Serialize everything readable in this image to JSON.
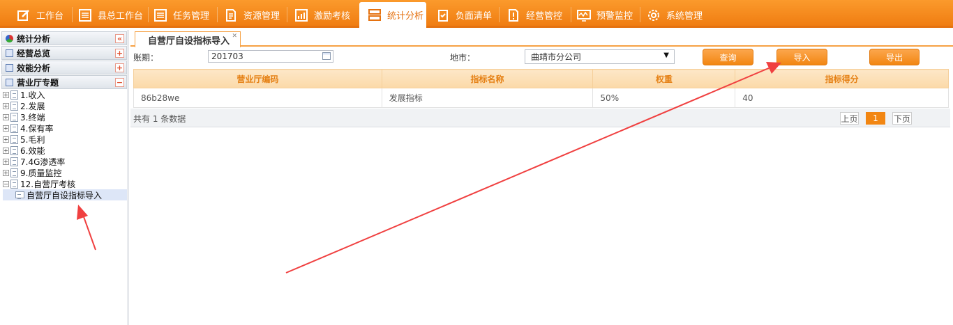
{
  "nav": {
    "items": [
      {
        "label": "工作台",
        "icon": "edit-icon"
      },
      {
        "label": "县总工作台",
        "icon": "list-icon"
      },
      {
        "label": "任务管理",
        "icon": "task-list-icon"
      },
      {
        "label": "资源管理",
        "icon": "document-icon"
      },
      {
        "label": "激励考核",
        "icon": "bar-chart-icon"
      },
      {
        "label": "统计分析",
        "icon": "server-icon",
        "active": true
      },
      {
        "label": "负面清单",
        "icon": "clipboard-check-icon"
      },
      {
        "label": "经营管控",
        "icon": "alert-file-icon"
      },
      {
        "label": "预警监控",
        "icon": "monitor-icon"
      },
      {
        "label": "系统管理",
        "icon": "gear-icon"
      }
    ]
  },
  "sidebar": {
    "title": "统计分析",
    "sections": [
      "经营总览",
      "效能分析",
      "营业厅专题"
    ],
    "tree": [
      "1.收入",
      "2.发展",
      "3.终端",
      "4.保有率",
      "5.毛利",
      "6.效能",
      "7.4G渗透率",
      "9.质量监控",
      "12.自营厅考核"
    ],
    "selected_leaf": "自营厅自设指标导入"
  },
  "main": {
    "tab_label": "自营厅自设指标导入",
    "form": {
      "period_label": "账期：",
      "period_value": "201703",
      "city_label": "地市：",
      "city_value": "曲靖市分公司"
    },
    "buttons": {
      "query": "查询",
      "import": "导入",
      "export": "导出"
    },
    "table": {
      "columns": [
        "营业厅编码",
        "指标名称",
        "权重",
        "指标得分"
      ],
      "rows": [
        [
          "86b28we",
          "发展指标",
          "50%",
          "40"
        ]
      ]
    },
    "footer": {
      "summary": "共有 1 条数据",
      "prev": "上页",
      "page": "1",
      "next": "下页"
    }
  },
  "colors": {
    "accent": "#f28612",
    "annotation_arrow": "#f04040"
  }
}
